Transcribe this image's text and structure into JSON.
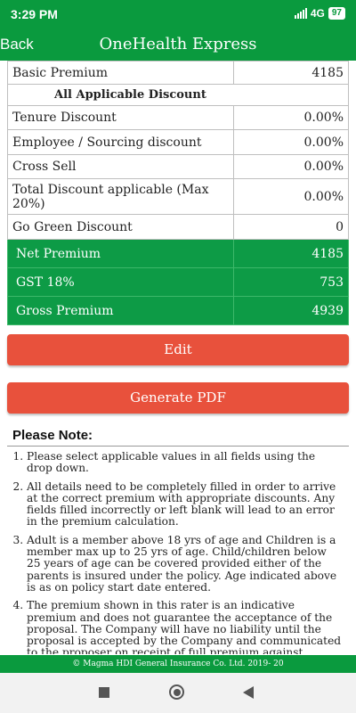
{
  "status": {
    "time": "3:29 PM",
    "network": "4G",
    "battery": "97"
  },
  "appbar": {
    "back_label": "Back",
    "title": "OneHealth Express"
  },
  "premium_table": {
    "basic": {
      "label": "Basic Premium",
      "value": "4185"
    },
    "discount_header": "All Applicable Discount",
    "tenure": {
      "label": "Tenure Discount",
      "value": "0.00%"
    },
    "employee": {
      "label": "Employee / Sourcing discount",
      "value": "0.00%"
    },
    "cross_sell": {
      "label": "Cross Sell",
      "value": "0.00%"
    },
    "total_discount": {
      "label": "Total Discount applicable (Max 20%)",
      "value": "0.00%"
    },
    "go_green": {
      "label": "Go Green Discount",
      "value": "0"
    },
    "net": {
      "label": "Net Premium",
      "value": "4185"
    },
    "gst": {
      "label": "GST 18%",
      "value": "753"
    },
    "gross": {
      "label": "Gross Premium",
      "value": "4939"
    }
  },
  "buttons": {
    "edit": "Edit",
    "generate_pdf": "Generate PDF"
  },
  "notes": {
    "title": "Please Note:",
    "items": [
      "Please select applicable values in all fields using the drop down.",
      "All details need to be completely filled in order to arrive at the correct premium with appropriate discounts. Any fields filled incorrectly or left blank will lead to an error in the premium calculation.",
      "Adult is a member above 18 yrs of age and Children is a member max up to 25 yrs of age. Child/children below 25 years of age can be covered provided either of the parents is insured under the policy. Age indicated above is as on policy start date entered.",
      "The premium shown in this rater is an indicative premium and does not guarantee the acceptance of the proposal. The Company will have no liability until the proposal is accepted by the Company and communicated to the proposer on receipt of full premium against."
    ]
  },
  "footer": {
    "text": "© Magma HDI General Insurance Co. Ltd. 2019- 20"
  },
  "colors": {
    "primary_green": "#0a9a3e",
    "button_orange": "#e8513c"
  }
}
